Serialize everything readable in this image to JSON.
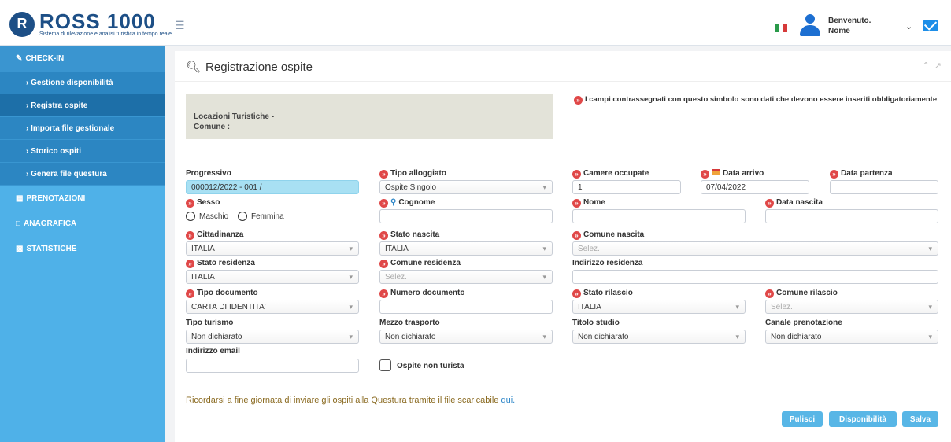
{
  "header": {
    "logo_title": "ROSS 1000",
    "logo_sub": "Sistema di rilevazione e analisi turistica in tempo reale",
    "welcome": "Benvenuto.",
    "user": "Nome"
  },
  "sidebar": {
    "checkin": "CHECK-IN",
    "sub": [
      "› Gestione disponibilità",
      "› Registra ospite",
      "› Importa file gestionale",
      "› Storico ospiti",
      "› Genera file questura"
    ],
    "prenotazioni": "PRENOTAZIONI",
    "anagrafica": "ANAGRAFICA",
    "statistiche": "STATISTICHE"
  },
  "panel": {
    "title": "Registrazione ospite",
    "loc_line1": "Locazioni Turistiche -",
    "loc_line2": "Comune :",
    "notice": "I campi contrassegnati con questo simbolo sono dati che devono essere inseriti obbligatoriamente"
  },
  "form": {
    "progressivo_label": "Progressivo",
    "progressivo_value": "000012/2022  - 001 /",
    "tipo_alloggiato_label": "Tipo alloggiato",
    "tipo_alloggiato_value": "Ospite Singolo",
    "camere_label": "Camere occupate",
    "camere_value": "1",
    "data_arrivo_label": "Data arrivo",
    "data_arrivo_value": "07/04/2022",
    "data_partenza_label": "Data partenza",
    "sesso_label": "Sesso",
    "maschio": "Maschio",
    "femmina": "Femmina",
    "cognome_label": "Cognome",
    "nome_label": "Nome",
    "data_nascita_label": "Data nascita",
    "cittadinanza_label": "Cittadinanza",
    "cittadinanza_value": "ITALIA",
    "stato_nascita_label": "Stato nascita",
    "stato_nascita_value": "ITALIA",
    "comune_nascita_label": "Comune nascita",
    "comune_nascita_placeholder": "Selez.",
    "stato_residenza_label": "Stato residenza",
    "stato_residenza_value": "ITALIA",
    "comune_residenza_label": "Comune residenza",
    "comune_residenza_placeholder": "Selez.",
    "indirizzo_residenza_label": "Indirizzo residenza",
    "tipo_documento_label": "Tipo documento",
    "tipo_documento_value": "CARTA DI IDENTITA'",
    "numero_documento_label": "Numero documento",
    "stato_rilascio_label": "Stato rilascio",
    "stato_rilascio_value": "ITALIA",
    "comune_rilascio_label": "Comune rilascio",
    "comune_rilascio_placeholder": "Selez.",
    "tipo_turismo_label": "Tipo turismo",
    "tipo_turismo_value": "Non dichiarato",
    "mezzo_trasporto_label": "Mezzo trasporto",
    "mezzo_trasporto_value": "Non dichiarato",
    "titolo_studio_label": "Titolo studio",
    "titolo_studio_value": "Non dichiarato",
    "canale_label": "Canale prenotazione",
    "canale_value": "Non dichiarato",
    "email_label": "Indirizzo email",
    "ospite_non_turista": "Ospite non turista"
  },
  "reminder": {
    "text": "Ricordarsi a fine giornata di inviare gli ospiti alla Questura tramite il file scaricabile ",
    "link": "qui."
  },
  "buttons": {
    "pulisci": "Pulisci",
    "disponibilita": "Disponibilità",
    "salva": "Salva"
  },
  "colors": {
    "sidebar": "#4fb1e8",
    "sidebar_sub": "#2c86c2",
    "brand": "#1d4f86",
    "required": "#e04848",
    "button": "#58b6e6"
  },
  "icons": {
    "menu": "hamburger-icon",
    "search": "search-icon",
    "flag": "italy-flag-icon",
    "user": "user-icon",
    "mail": "mail-icon"
  }
}
